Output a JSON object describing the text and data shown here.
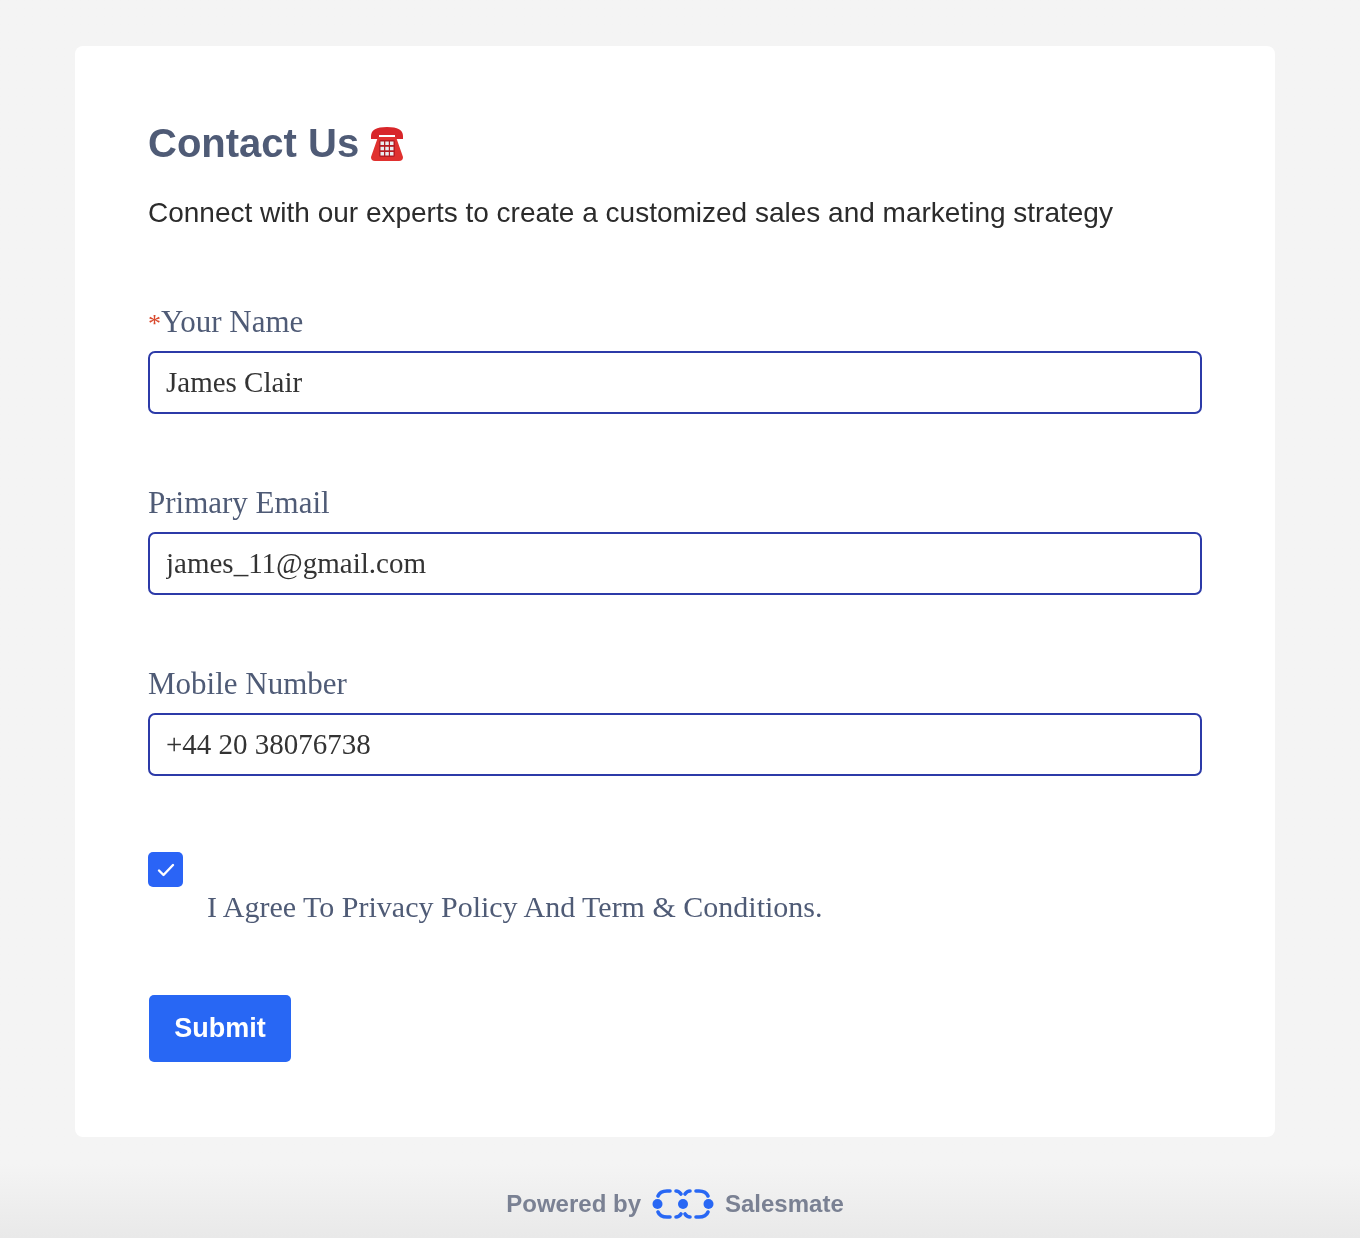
{
  "form": {
    "title": "Contact Us",
    "subtitle": "Connect with our experts to create a customized sales and marketing strategy",
    "fields": [
      {
        "marker": "*",
        "label": "Your Name",
        "value": "James Clair"
      },
      {
        "label": "Primary Email",
        "value": "james_11@gmail.com"
      },
      {
        "label": "Mobile Number",
        "value": "+44 20 38076738"
      }
    ],
    "consent": {
      "checked": true,
      "label": "I Agree To Privacy Policy And Term & Conditions."
    },
    "submit": "Submit"
  },
  "footer": {
    "prefix": "Powered by",
    "brand": "Salesmate"
  }
}
